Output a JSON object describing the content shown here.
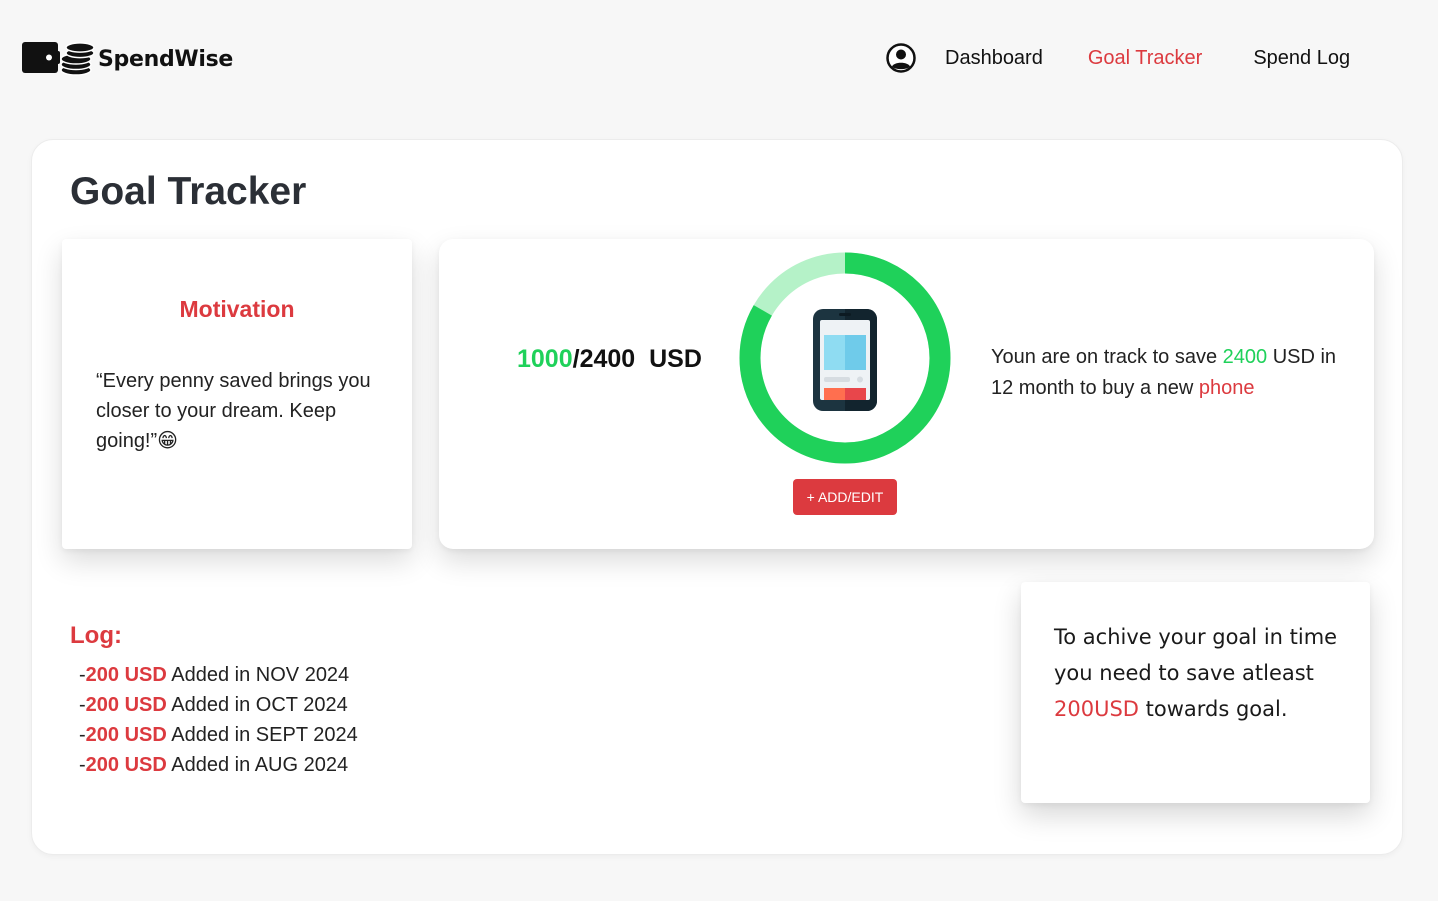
{
  "app": {
    "name": "SpendWise",
    "logo_icon": "wallet-coins-icon"
  },
  "nav": {
    "avatar_icon": "user-avatar-icon",
    "items": [
      {
        "label": "Dashboard",
        "active": false
      },
      {
        "label": "Goal Tracker",
        "active": true
      },
      {
        "label": "Spend Log",
        "active": false
      }
    ]
  },
  "page": {
    "title": "Goal Tracker"
  },
  "motivation": {
    "title": "Motivation",
    "quote": " “Every penny saved brings you closer to your dream. Keep going!”😁"
  },
  "goal": {
    "saved": "1000",
    "separator": "/",
    "target": "2400",
    "currency": "  USD",
    "progress_fraction": 0.8333,
    "goal_item_icon": "smartphone-icon",
    "add_button_label": "+ ADD/EDIT",
    "track_prefix": "Youn are on track to save ",
    "track_amount": "2400",
    "track_middle": " USD in 12 month to buy a new ",
    "track_item": "phone"
  },
  "log": {
    "title": "Log:",
    "entries": [
      {
        "prefix": "-",
        "amount": "200 USD",
        "text": " Added in NOV 2024"
      },
      {
        "prefix": "-",
        "amount": "200 USD",
        "text": " Added in OCT 2024"
      },
      {
        "prefix": "-",
        "amount": "200 USD",
        "text": " Added in SEPT 2024"
      },
      {
        "prefix": "-",
        "amount": "200 USD",
        "text": " Added in AUG 2024"
      }
    ]
  },
  "advice": {
    "prefix": "To achive your goal in time you need to save atleast ",
    "amount": "200USD",
    "suffix": " towards goal."
  },
  "colors": {
    "accent_red": "#dc3a3f",
    "progress_green": "#1fd15a",
    "progress_track": "#b5f2c8",
    "title_dark": "#2b2f36"
  }
}
